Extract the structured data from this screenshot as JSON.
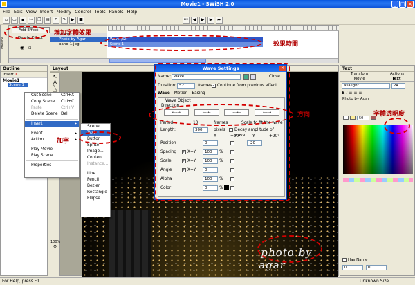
{
  "window": {
    "title": "Movie1 - SWiSH 2.0",
    "min": "_",
    "max": "□",
    "close": "×"
  },
  "menu": [
    "File",
    "Edit",
    "View",
    "Insert",
    "Modify",
    "Control",
    "Tools",
    "Panels",
    "Help"
  ],
  "toolbar": {
    "add_effect": "Add Effect",
    "delete_effect": "Delete Effect",
    "side_label": "Timeline"
  },
  "timeline": {
    "rows": [
      "Scene 1",
      "Photo by Agar",
      "pano-1.jpg"
    ],
    "track_label": "Wave (52)",
    "track_label2": "Scene 1"
  },
  "outline": {
    "header": "Outline",
    "insert": "Insert",
    "tree_root": "Movie1",
    "tree_scene": "Scene 1"
  },
  "layout": {
    "header": "Layout",
    "zoom": "100%"
  },
  "context_menu": {
    "items": [
      {
        "label": "Cut Scene",
        "shortcut": "Ctrl+X",
        "disabled": false
      },
      {
        "label": "Copy Scene",
        "shortcut": "Ctrl+C",
        "disabled": false
      },
      {
        "label": "Paste",
        "shortcut": "Ctrl+V",
        "disabled": true
      },
      {
        "label": "Delete Scene",
        "shortcut": "Del",
        "disabled": false
      }
    ],
    "insert": "Insert",
    "event": "Event",
    "action": "Action",
    "play_movie": "Play Movie",
    "play_scene": "Play Scene",
    "properties": "Properties"
  },
  "submenu": {
    "items": [
      "Scene",
      "Text",
      "Button",
      "Sprite",
      "Image...",
      "Content...",
      "Instance...",
      "Line",
      "Pencil",
      "Bezier",
      "Rectangle",
      "Ellipse"
    ]
  },
  "dialog": {
    "title": "Wave Settings",
    "name_label": "Name:",
    "name_value": "Wave",
    "close": "Close",
    "duration_label": "Duration:",
    "duration_value": "52",
    "frames": "frames",
    "continue": "Continue from previous effect",
    "tabs": [
      "Wave",
      "Motion",
      "Easing"
    ],
    "wave_object": "Wave Object",
    "direction": "Direction",
    "dir_options": [
      "←--→",
      "←--←",
      "--→←",
      "←--→"
    ],
    "period_label": "Period:",
    "period_value": "10",
    "period_unit": "frames",
    "scale_note": "Scale to fit the wave",
    "length_label": "Length:",
    "length_value": "300",
    "length_unit": "pixels",
    "decay": "Decay amplitude of wave",
    "col_x": "X",
    "col_y": "Y",
    "plus90": "+90°",
    "rows": [
      {
        "label": "Position",
        "v1": "0",
        "v2": "-20"
      },
      {
        "label": "Spacing",
        "xy": "X=Y",
        "v1": "100",
        "unit": "%"
      },
      {
        "label": "Scale",
        "xy": "X=Y",
        "v1": "100",
        "unit": "%"
      },
      {
        "label": "Angle",
        "xy": "X=Y",
        "v1": "0"
      },
      {
        "label": "Alpha",
        "v1": "100",
        "unit": "%"
      },
      {
        "label": "Color",
        "v1": "0",
        "unit": "%"
      }
    ]
  },
  "text_panel": {
    "header": "Text",
    "tabs": [
      "Transform",
      "Actions",
      "Movie",
      "Text"
    ],
    "font": "asalight",
    "size": "24",
    "sample": "Photo by Agar",
    "alpha_value": "50",
    "has_name": "Has Name",
    "pos_x": "0",
    "pos_y": "0"
  },
  "scene_text": "photo by agar",
  "annotations": {
    "add_effect": "增加字體效果",
    "effect_time": "效果時間",
    "direction": "方向",
    "add_text": "加字",
    "text_alpha": "字體透明度"
  },
  "status": {
    "help": "For Help, press F1",
    "size": "Unknown Size"
  }
}
